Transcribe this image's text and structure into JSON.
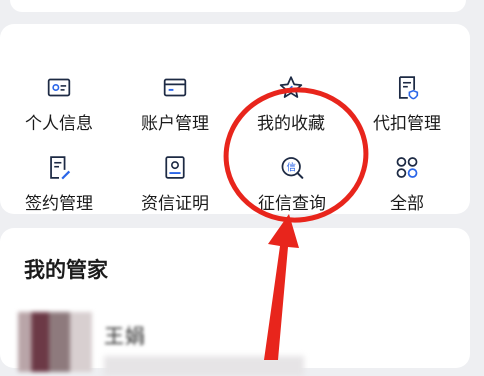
{
  "grid": {
    "items": [
      {
        "label": "个人信息"
      },
      {
        "label": "账户管理"
      },
      {
        "label": "我的收藏"
      },
      {
        "label": "代扣管理"
      },
      {
        "label": "签约管理"
      },
      {
        "label": "资信证明"
      },
      {
        "label": "征信查询"
      },
      {
        "label": "全部"
      }
    ]
  },
  "steward": {
    "title": "我的管家",
    "name": "王娟"
  },
  "annotation": {
    "color": "#e8251c"
  },
  "icon_colors": {
    "dark": "#1d2a44",
    "accent": "#2b66e8"
  }
}
